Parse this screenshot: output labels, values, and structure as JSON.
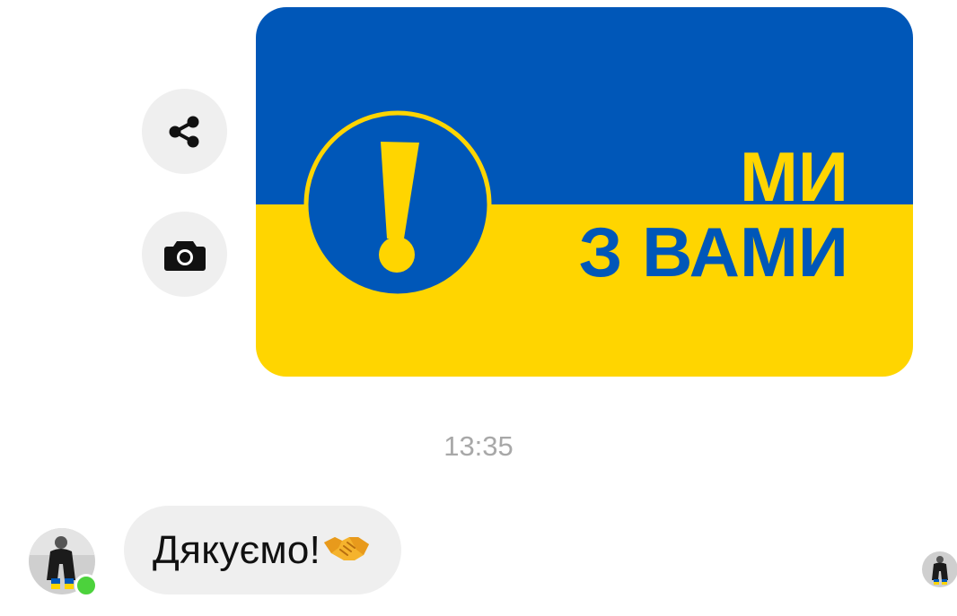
{
  "thread": {
    "sent_image": {
      "headline_line1": "МИ",
      "headline_line2": "З ВАМИ",
      "colors": {
        "blue": "#0057b8",
        "yellow": "#ffd500"
      }
    },
    "actions": [
      {
        "id": "share",
        "icon": "share-icon"
      },
      {
        "id": "camera",
        "icon": "camera-icon"
      }
    ],
    "timestamp": "13:35",
    "incoming_message": {
      "text": "Дякуємо!",
      "emoji": "handshake-emoji"
    },
    "contact": {
      "online": true,
      "presence_color": "#4cd23c"
    }
  }
}
